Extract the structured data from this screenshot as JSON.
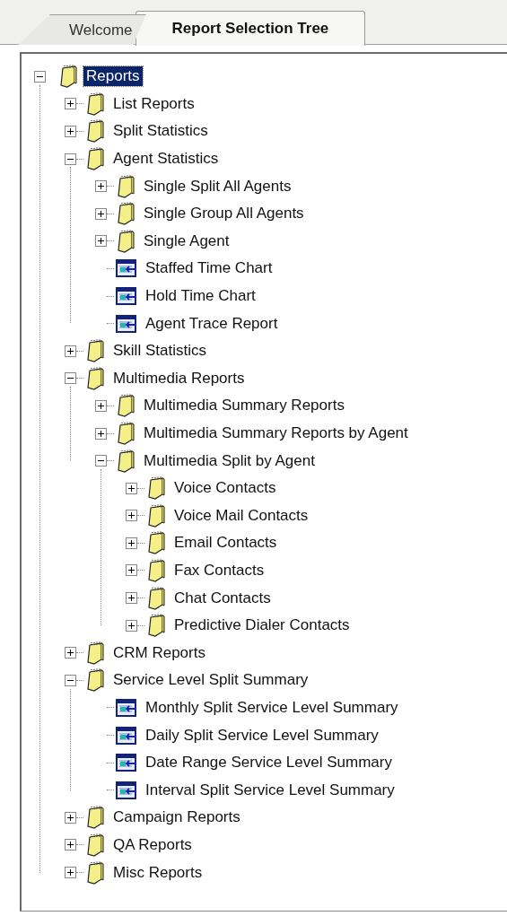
{
  "tabs": [
    {
      "label": "Welcome",
      "selected": false
    },
    {
      "label": "Report Selection Tree",
      "selected": true
    }
  ],
  "tree": [
    {
      "label": "Reports",
      "kind": "folder",
      "expanded": true,
      "selected": true,
      "children": [
        {
          "label": "List Reports",
          "kind": "folder",
          "expanded": false,
          "selected": false
        },
        {
          "label": "Split Statistics",
          "kind": "folder",
          "expanded": false,
          "selected": false
        },
        {
          "label": "Agent Statistics",
          "kind": "folder",
          "expanded": true,
          "selected": false,
          "children": [
            {
              "label": "Single Split All Agents",
              "kind": "folder",
              "expanded": false,
              "selected": false
            },
            {
              "label": "Single Group All Agents",
              "kind": "folder",
              "expanded": false,
              "selected": false
            },
            {
              "label": "Single Agent",
              "kind": "folder",
              "expanded": false,
              "selected": false
            },
            {
              "label": "Staffed Time Chart",
              "kind": "report",
              "selected": false
            },
            {
              "label": "Hold Time Chart",
              "kind": "report",
              "selected": false
            },
            {
              "label": "Agent Trace Report",
              "kind": "report",
              "selected": false
            }
          ]
        },
        {
          "label": "Skill Statistics",
          "kind": "folder",
          "expanded": false,
          "selected": false
        },
        {
          "label": "Multimedia Reports",
          "kind": "folder",
          "expanded": true,
          "selected": false,
          "children": [
            {
              "label": "Multimedia Summary Reports",
              "kind": "folder",
              "expanded": false,
              "selected": false
            },
            {
              "label": "Multimedia Summary Reports by Agent",
              "kind": "folder",
              "expanded": false,
              "selected": false
            },
            {
              "label": "Multimedia Split by Agent",
              "kind": "folder",
              "expanded": true,
              "selected": false,
              "children": [
                {
                  "label": "Voice Contacts",
                  "kind": "folder",
                  "expanded": false,
                  "selected": false
                },
                {
                  "label": "Voice Mail Contacts",
                  "kind": "folder",
                  "expanded": false,
                  "selected": false
                },
                {
                  "label": "Email Contacts",
                  "kind": "folder",
                  "expanded": false,
                  "selected": false
                },
                {
                  "label": "Fax Contacts",
                  "kind": "folder",
                  "expanded": false,
                  "selected": false
                },
                {
                  "label": "Chat Contacts",
                  "kind": "folder",
                  "expanded": false,
                  "selected": false
                },
                {
                  "label": "Predictive Dialer Contacts",
                  "kind": "folder",
                  "expanded": false,
                  "selected": false
                }
              ]
            }
          ]
        },
        {
          "label": "CRM Reports",
          "kind": "folder",
          "expanded": false,
          "selected": false
        },
        {
          "label": "Service Level Split Summary",
          "kind": "folder",
          "expanded": true,
          "selected": false,
          "children": [
            {
              "label": "Monthly Split Service Level Summary",
              "kind": "report",
              "selected": false
            },
            {
              "label": "Daily Split Service Level Summary",
              "kind": "report",
              "selected": false
            },
            {
              "label": "Date Range Service Level Summary",
              "kind": "report",
              "selected": false
            },
            {
              "label": "Interval Split Service Level Summary",
              "kind": "report",
              "selected": false
            }
          ]
        },
        {
          "label": "Campaign Reports",
          "kind": "folder",
          "expanded": false,
          "selected": false
        },
        {
          "label": "QA Reports",
          "kind": "folder",
          "expanded": false,
          "selected": false
        },
        {
          "label": "Misc Reports",
          "kind": "folder",
          "expanded": false,
          "selected": false
        }
      ]
    }
  ]
}
